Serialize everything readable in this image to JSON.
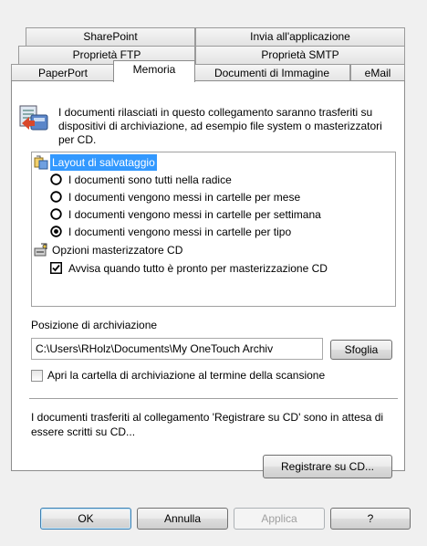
{
  "tabs": {
    "row1": [
      {
        "label": "SharePoint"
      },
      {
        "label": "Invia all'applicazione"
      }
    ],
    "row2": [
      {
        "label": "Proprietà FTP"
      },
      {
        "label": "Proprietà SMTP"
      }
    ],
    "row3": [
      {
        "label": "PaperPort"
      },
      {
        "label": "Memoria",
        "active": true
      },
      {
        "label": "Documenti di Immagine"
      },
      {
        "label": "eMail"
      }
    ]
  },
  "info": {
    "icon": "storage-transfer-icon",
    "text": "I documenti rilasciati in questo collegamento saranno trasferiti su dispositivi di archiviazione, ad esempio file system o masterizzatori per CD."
  },
  "options": {
    "layout_group": {
      "label": "Layout di salvataggio",
      "icon": "layout-folders-icon",
      "selected": true
    },
    "radios": [
      {
        "label": "I documenti sono tutti nella radice",
        "checked": false
      },
      {
        "label": "I documenti vengono messi in cartelle per mese",
        "checked": false
      },
      {
        "label": "I documenti vengono messi in cartelle per settimana",
        "checked": false
      },
      {
        "label": "I documenti vengono messi in cartelle per tipo",
        "checked": true
      }
    ],
    "cd_group": {
      "label": "Opzioni masterizzatore CD",
      "icon": "cd-burner-icon"
    },
    "cd_notify": {
      "label": "Avvisa quando tutto è pronto per masterizzazione CD",
      "checked": true
    }
  },
  "storage": {
    "label": "Posizione di archiviazione",
    "path": "C:\\Users\\RHolz\\Documents\\My OneTouch Archiv",
    "browse_label": "Sfoglia",
    "open_folder_label": "Apri la cartella di archiviazione al termine della scansione",
    "open_folder_checked": false
  },
  "cd_note": {
    "text": "I documenti trasferiti al collegamento 'Registrare su CD' sono in attesa di essere scritti su CD...",
    "burn_label": "Registrare su CD..."
  },
  "buttons": {
    "ok": "OK",
    "cancel": "Annulla",
    "apply": "Applica",
    "help": "?"
  }
}
